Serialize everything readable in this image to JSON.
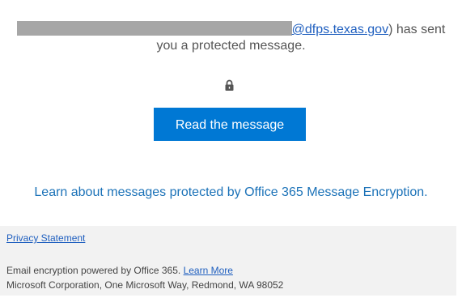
{
  "sender": {
    "email_domain": "@dfps.texas.gov",
    "open_paren": "",
    "close_paren_text": ") has sent",
    "line2": "you a protected message."
  },
  "lock_icon": "lock-icon",
  "button": {
    "label": "Read the message",
    "color": "#0078d4"
  },
  "learn_link": "Learn about messages protected by Office 365 Message Encryption.",
  "footer": {
    "privacy": "Privacy Statement",
    "powered_by": "Email encryption powered by Office 365.",
    "learn_more": "Learn More",
    "address": "Microsoft Corporation, One Microsoft Way, Redmond, WA 98052"
  },
  "colors": {
    "accent": "#0078d4",
    "link": "#1b72b8",
    "redaction": "#a6a6a6",
    "footer_bg": "#f2f2f2"
  }
}
